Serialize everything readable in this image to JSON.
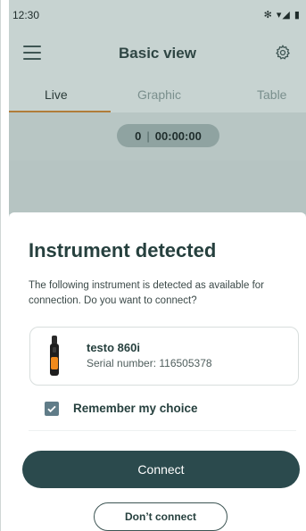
{
  "status_bar": {
    "time": "12:30",
    "icons": "✻ ▾◢ ▮"
  },
  "top_bar": {
    "title": "Basic view"
  },
  "tabs": [
    {
      "label": "Live",
      "active": true
    },
    {
      "label": "Graphic",
      "active": false
    },
    {
      "label": "Table",
      "active": false
    }
  ],
  "counter": {
    "count": "0",
    "separator": "|",
    "elapsed": "00:00:00"
  },
  "dialog": {
    "title": "Instrument detected",
    "description": "The following instrument is detected as available for connection. Do you want to connect?",
    "instrument": {
      "name": "testo 860i",
      "serial": "Serial number: 116505378"
    },
    "remember": {
      "label": "Remember my choice",
      "checked": true
    },
    "connect_label": "Connect",
    "dont_connect_label": "Don’t connect"
  },
  "colors": {
    "primary": "#2b4a4d",
    "accent_tab": "#b07c3a",
    "checkbox": "#607c88"
  }
}
